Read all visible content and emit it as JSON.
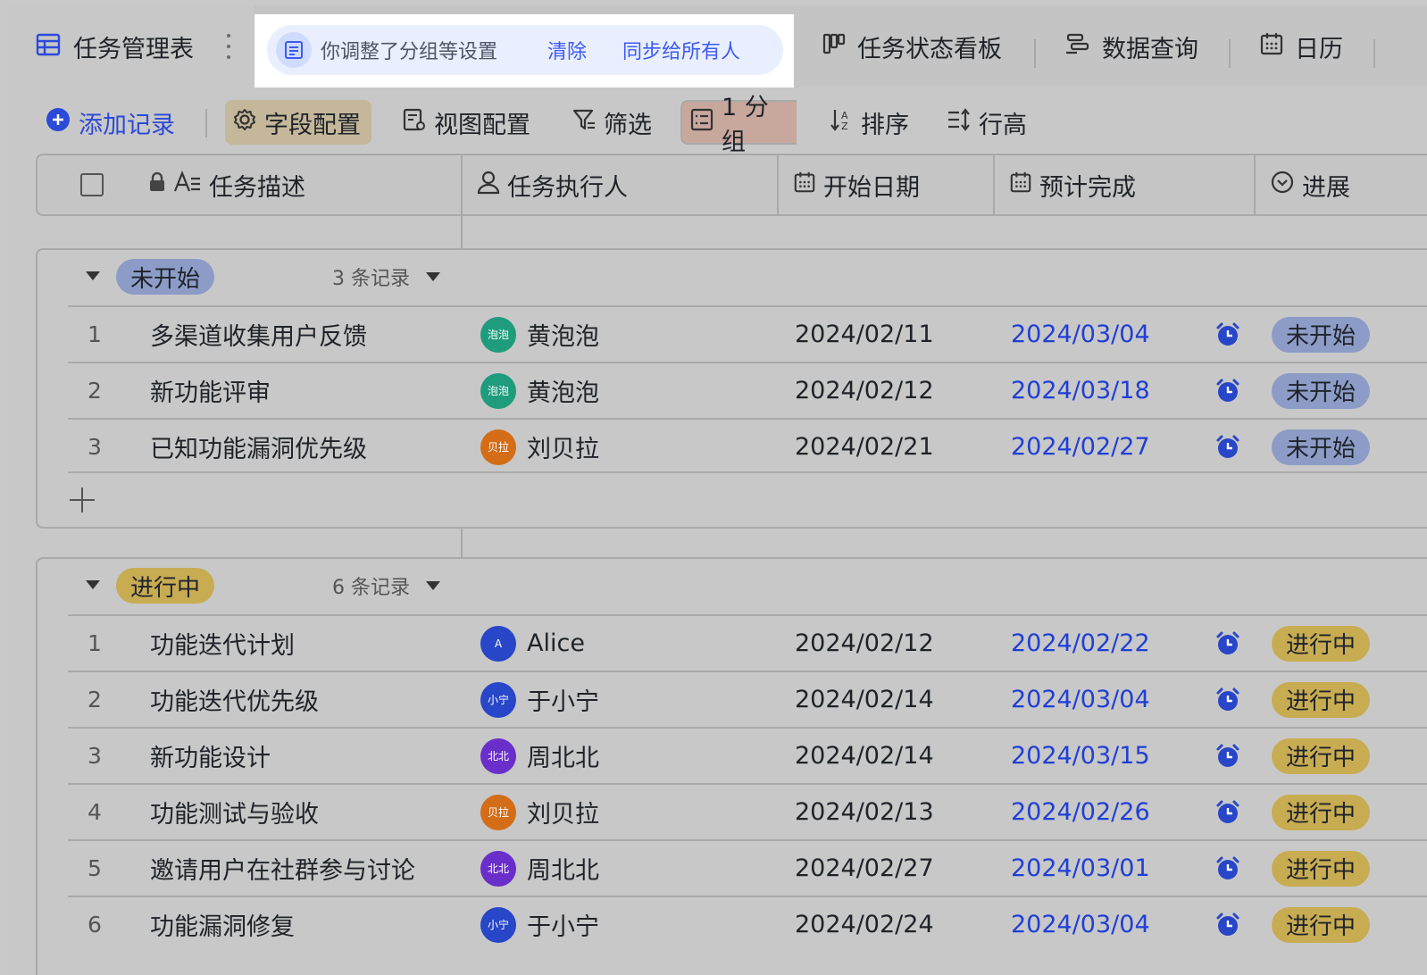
{
  "tabs": {
    "main_label": "任务管理表",
    "notice_text": "你调整了分组等设置",
    "notice_clear": "清除",
    "notice_sync": "同步给所有人",
    "kanban": "任务状态看板",
    "query": "数据查询",
    "calendar": "日历"
  },
  "toolbar": {
    "add": "添加记录",
    "fields": "字段配置",
    "view": "视图配置",
    "filter": "筛选",
    "group": "1 分组",
    "sort": "排序",
    "row_height": "行高"
  },
  "columns": {
    "desc": "任务描述",
    "assignee": "任务执行人",
    "start": "开始日期",
    "due": "预计完成",
    "progress": "进展"
  },
  "groups": [
    {
      "label": "未开始",
      "count": "3 条记录",
      "color": "#8c9cc7",
      "rows": [
        {
          "num": "1",
          "desc": "多渠道收集用户反馈",
          "avatar": "泡泡",
          "avatar_color": "#1e9c7c",
          "name": "黄泡泡",
          "start": "2024/02/11",
          "due": "2024/03/04",
          "status": "未开始"
        },
        {
          "num": "2",
          "desc": "新功能评审",
          "avatar": "泡泡",
          "avatar_color": "#1e9c7c",
          "name": "黄泡泡",
          "start": "2024/02/12",
          "due": "2024/03/18",
          "status": "未开始"
        },
        {
          "num": "3",
          "desc": "已知功能漏洞优先级",
          "avatar": "贝拉",
          "avatar_color": "#d36d17",
          "name": "刘贝拉",
          "start": "2024/02/21",
          "due": "2024/02/27",
          "status": "未开始"
        }
      ]
    },
    {
      "label": "进行中",
      "count": "6 条记录",
      "color": "#c8ac52",
      "rows": [
        {
          "num": "1",
          "desc": "功能迭代计划",
          "avatar": "A",
          "avatar_color": "#2746c8",
          "name": "Alice",
          "start": "2024/02/12",
          "due": "2024/02/22",
          "status": "进行中"
        },
        {
          "num": "2",
          "desc": "功能迭代优先级",
          "avatar": "小宁",
          "avatar_color": "#2746c8",
          "name": "于小宁",
          "start": "2024/02/14",
          "due": "2024/03/04",
          "status": "进行中"
        },
        {
          "num": "3",
          "desc": "新功能设计",
          "avatar": "北北",
          "avatar_color": "#6a2ecb",
          "name": "周北北",
          "start": "2024/02/14",
          "due": "2024/03/15",
          "status": "进行中"
        },
        {
          "num": "4",
          "desc": "功能测试与验收",
          "avatar": "贝拉",
          "avatar_color": "#d36d17",
          "name": "刘贝拉",
          "start": "2024/02/13",
          "due": "2024/02/26",
          "status": "进行中"
        },
        {
          "num": "5",
          "desc": "邀请用户在社群参与讨论",
          "avatar": "北北",
          "avatar_color": "#6a2ecb",
          "name": "周北北",
          "start": "2024/02/27",
          "due": "2024/03/01",
          "status": "进行中"
        },
        {
          "num": "6",
          "desc": "功能漏洞修复",
          "avatar": "小宁",
          "avatar_color": "#2746c8",
          "name": "于小宁",
          "start": "2024/02/24",
          "due": "2024/03/04",
          "status": "进行中"
        }
      ]
    }
  ]
}
